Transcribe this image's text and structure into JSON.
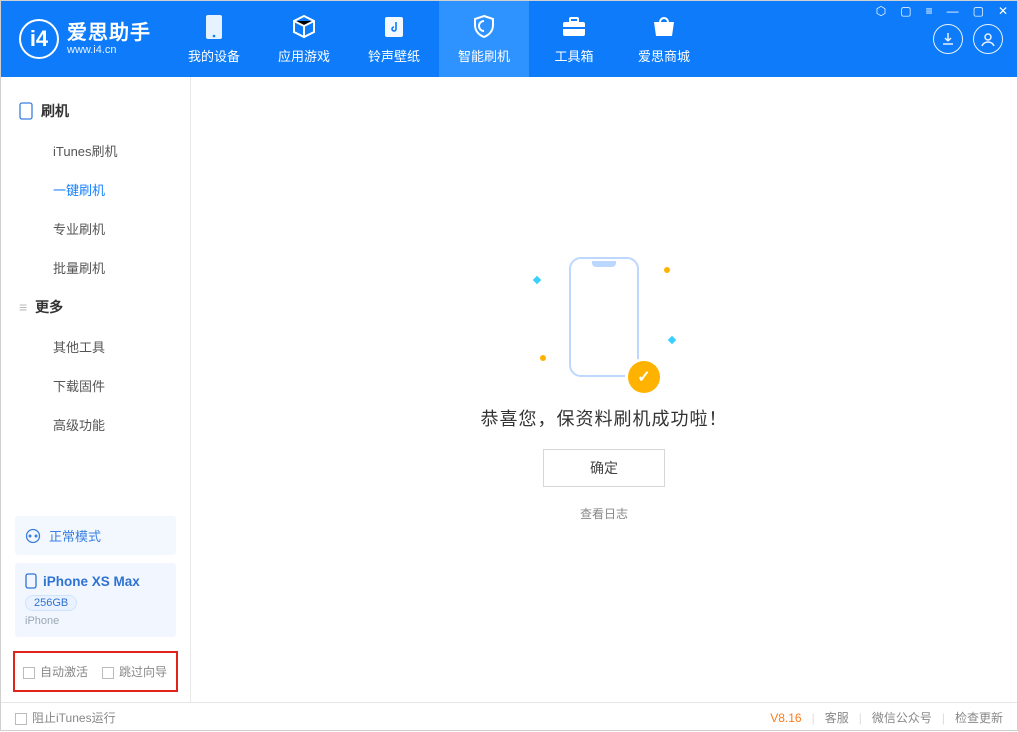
{
  "brand": {
    "title": "爱思助手",
    "url": "www.i4.cn"
  },
  "header_tabs": [
    {
      "label": "我的设备",
      "icon": "device-icon"
    },
    {
      "label": "应用游戏",
      "icon": "cube-icon"
    },
    {
      "label": "铃声壁纸",
      "icon": "music-icon"
    },
    {
      "label": "智能刷机",
      "icon": "shield-icon"
    },
    {
      "label": "工具箱",
      "icon": "toolbox-icon"
    },
    {
      "label": "爱思商城",
      "icon": "store-icon"
    }
  ],
  "sidebar": {
    "sections": [
      {
        "title": "刷机",
        "icon": "device-icon",
        "items": [
          "iTunes刷机",
          "一键刷机",
          "专业刷机",
          "批量刷机"
        ]
      },
      {
        "title": "更多",
        "icon": "menu-icon",
        "items": [
          "其他工具",
          "下载固件",
          "高级功能"
        ]
      }
    ],
    "mode": "正常模式",
    "device": {
      "name": "iPhone XS Max",
      "capacity": "256GB",
      "type": "iPhone"
    },
    "options": {
      "auto_activate": "自动激活",
      "skip_guide": "跳过向导"
    }
  },
  "main": {
    "success_msg": "恭喜您，保资料刷机成功啦！",
    "ok_label": "确定",
    "view_log": "查看日志"
  },
  "status": {
    "block_itunes": "阻止iTunes运行",
    "version": "V8.16",
    "links": [
      "客服",
      "微信公众号",
      "检查更新"
    ]
  }
}
